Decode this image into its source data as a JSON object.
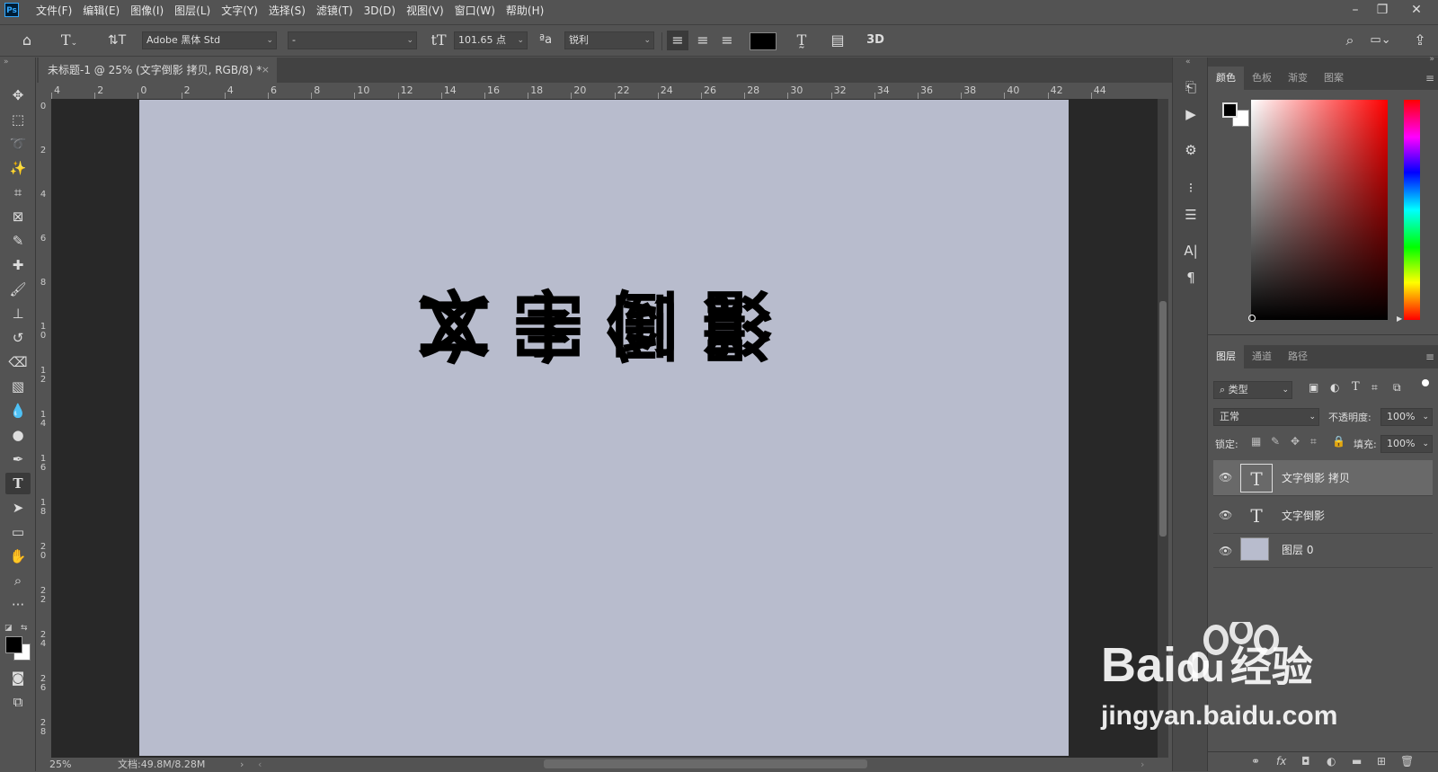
{
  "menubar": {
    "items": [
      "文件(F)",
      "编辑(E)",
      "图像(I)",
      "图层(L)",
      "文字(Y)",
      "选择(S)",
      "滤镜(T)",
      "3D(D)",
      "视图(V)",
      "窗口(W)",
      "帮助(H)"
    ]
  },
  "options": {
    "font_family": "Adobe 黑体 Std",
    "font_style": "-",
    "font_size": "101.65 点",
    "antialias": "锐利",
    "three_d": "3D",
    "text_color": "#000000"
  },
  "document": {
    "tab_title": "未标题-1 @ 25% (文字倒影 拷贝, RGB/8) *",
    "zoom": "25%",
    "doc_info": "文档:49.8M/8.28M",
    "canvas_color": "#b8bccd",
    "text_upright": [
      "文",
      "字",
      "倒",
      "影"
    ]
  },
  "ruler": {
    "h_labels": [
      "4",
      "2",
      "0",
      "2",
      "4",
      "6",
      "8",
      "10",
      "12",
      "14",
      "16",
      "18",
      "20",
      "22",
      "24",
      "26",
      "28",
      "30",
      "32",
      "34",
      "36",
      "38",
      "40",
      "42",
      "44"
    ],
    "v_labels": [
      "0",
      "2",
      "4",
      "6",
      "8",
      "10",
      "12",
      "14",
      "16",
      "18",
      "20",
      "22",
      "24",
      "26",
      "28"
    ]
  },
  "color_panel": {
    "tabs": [
      "颜色",
      "色板",
      "渐变",
      "图案"
    ],
    "foreground": "#000000",
    "background": "#ffffff",
    "hue": "#ff0000"
  },
  "layers_panel": {
    "tabs": [
      "图层",
      "通道",
      "路径"
    ],
    "filter_kind": "类型",
    "blend_mode": "正常",
    "opacity_label": "不透明度:",
    "opacity": "100%",
    "lock_label": "锁定:",
    "fill_label": "填充:",
    "fill": "100%",
    "layers": [
      {
        "name": "文字倒影 拷贝",
        "type": "text",
        "selected": true
      },
      {
        "name": "文字倒影",
        "type": "text",
        "selected": false
      },
      {
        "name": "图层 0",
        "type": "pixel",
        "selected": false
      }
    ]
  },
  "watermark": {
    "brand_bai": "Bai",
    "brand_du": "du",
    "brand_cn": "经验",
    "url": "jingyan.baidu.com"
  }
}
